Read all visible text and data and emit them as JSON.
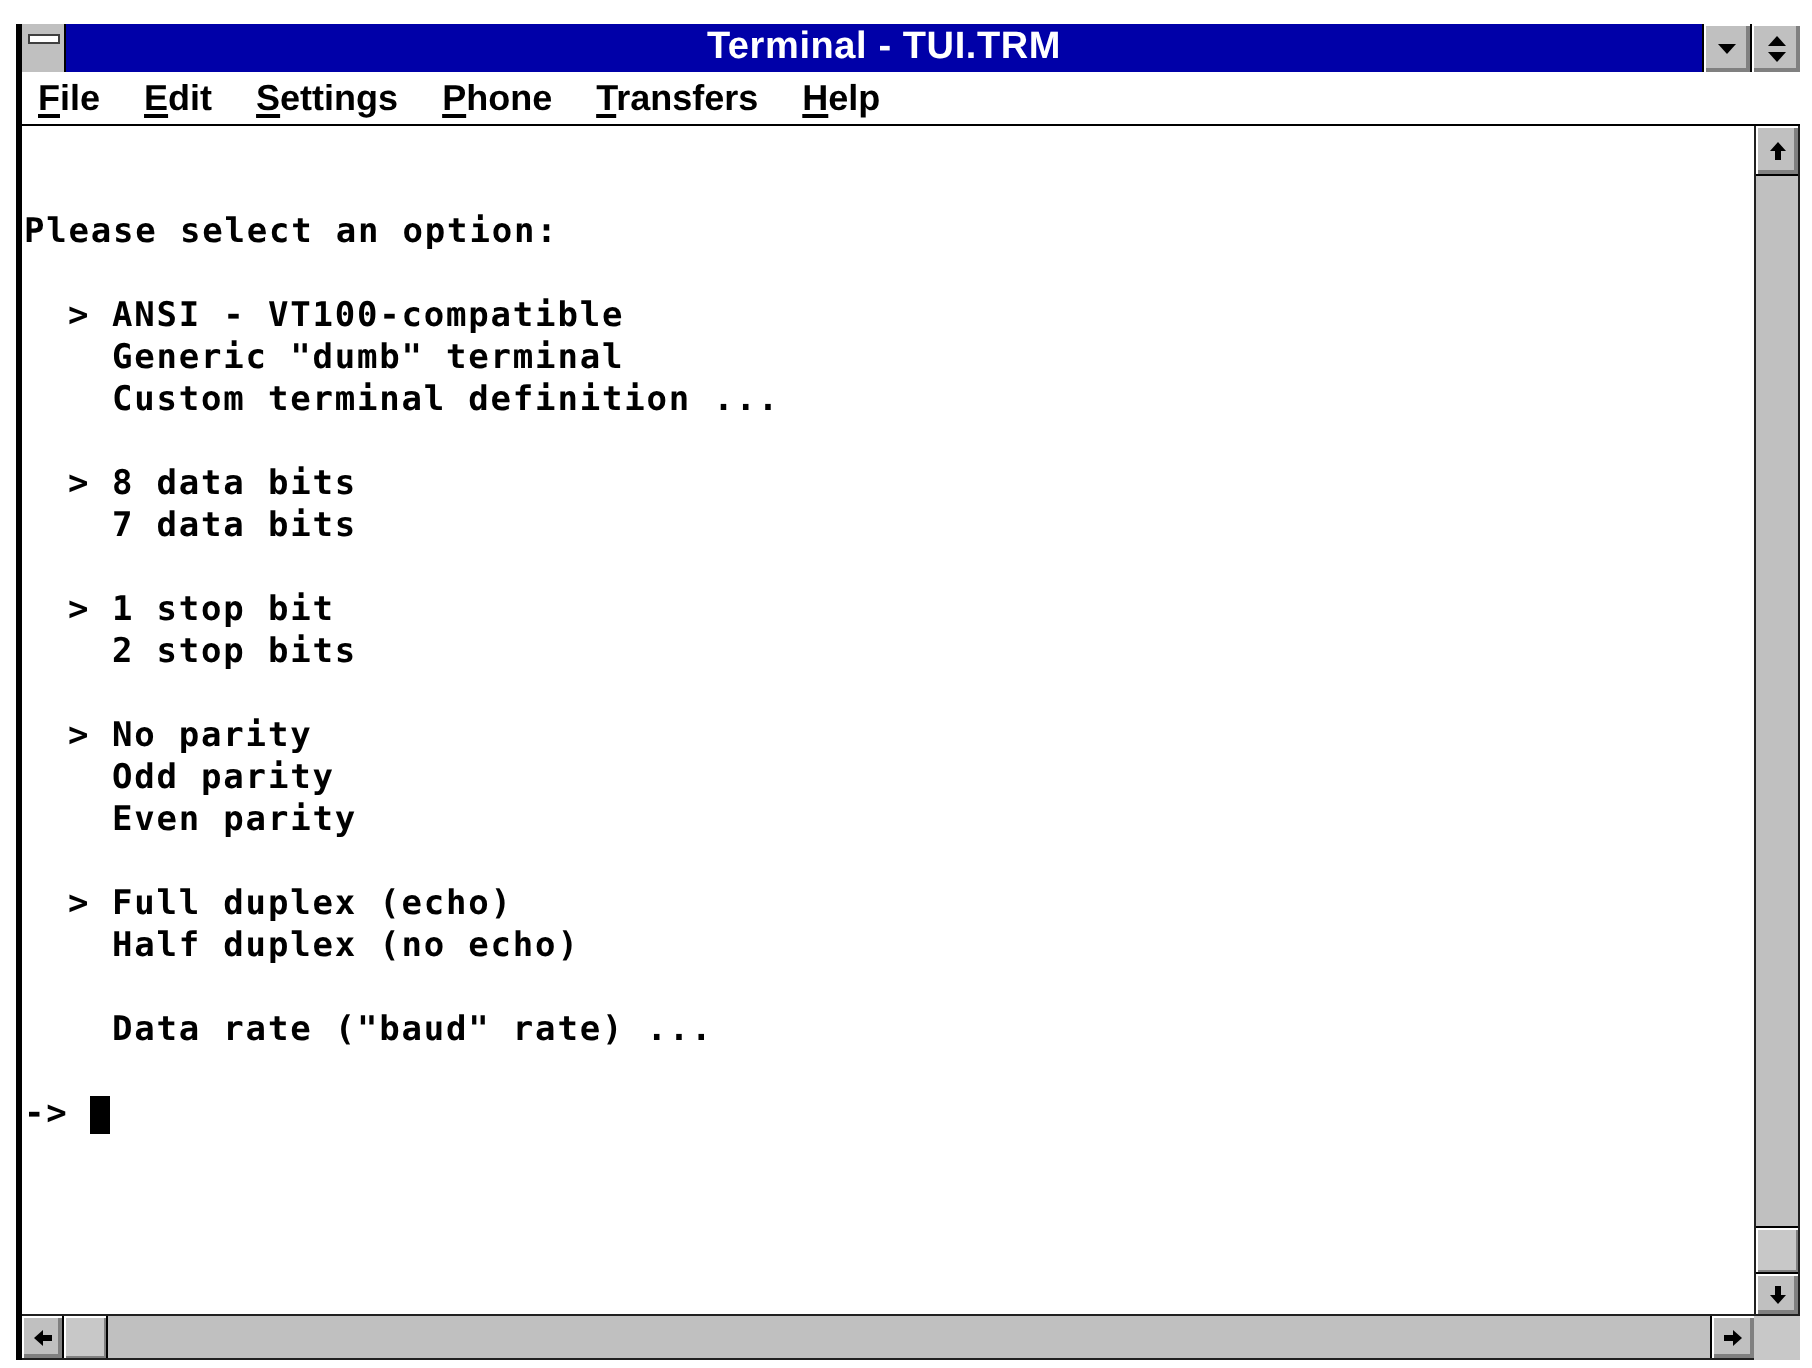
{
  "window": {
    "title": "Terminal - TUI.TRM"
  },
  "menu_bar": [
    {
      "label": "File",
      "mnemonic_underlined": true
    },
    {
      "label": "Edit",
      "mnemonic_underlined": true
    },
    {
      "label": "Settings",
      "mnemonic_underlined": true
    },
    {
      "label": "Phone",
      "mnemonic_underlined": true
    },
    {
      "label": "Transfers",
      "mnemonic_underlined": true
    },
    {
      "label": "Help",
      "mnemonic_underlined": true
    }
  ],
  "terminal": {
    "prompt_text": "Please select an option:",
    "option_groups": [
      {
        "marker": ">",
        "options": [
          {
            "label": "ANSI - VT100-compatible",
            "selected": true
          },
          {
            "label": "Generic \"dumb\" terminal",
            "selected": false
          },
          {
            "label": "Custom terminal definition ...",
            "selected": false
          }
        ]
      },
      {
        "marker": ">",
        "options": [
          {
            "label": "8 data bits",
            "selected": true
          },
          {
            "label": "7 data bits",
            "selected": false
          }
        ]
      },
      {
        "marker": ">",
        "options": [
          {
            "label": "1 stop bit",
            "selected": true
          },
          {
            "label": "2 stop bits",
            "selected": false
          }
        ]
      },
      {
        "marker": ">",
        "options": [
          {
            "label": "No parity",
            "selected": true
          },
          {
            "label": "Odd parity",
            "selected": false
          },
          {
            "label": "Even parity",
            "selected": false
          }
        ]
      },
      {
        "marker": ">",
        "options": [
          {
            "label": "Full duplex (echo)",
            "selected": true
          },
          {
            "label": "Half duplex (no echo)",
            "selected": false
          }
        ]
      }
    ],
    "extra_option": {
      "label": "Data rate (\"baud\" rate) ..."
    },
    "command_line": {
      "prompt": "->",
      "cursor_visible": true
    }
  }
}
